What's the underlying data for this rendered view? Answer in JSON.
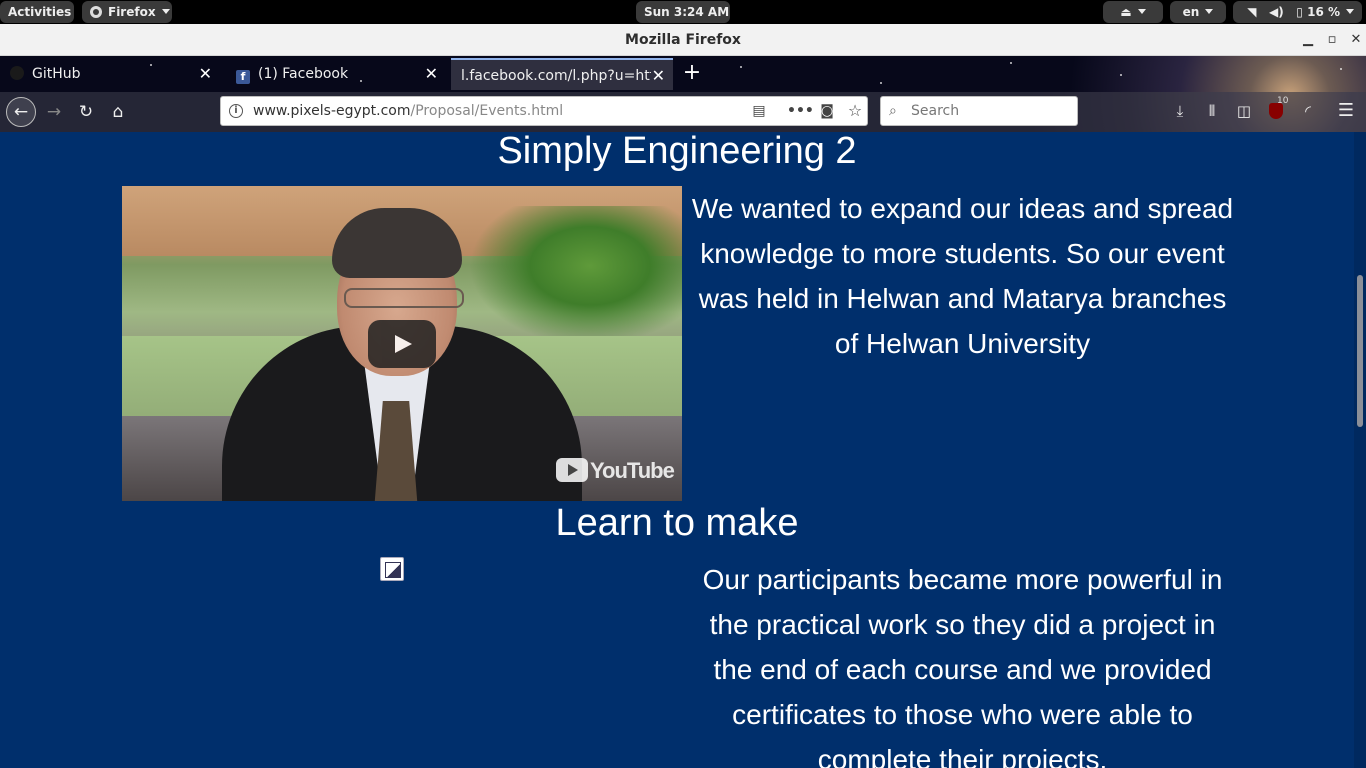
{
  "topbar": {
    "activities": "Activities",
    "app_menu": "Firefox",
    "clock": "Sun  3:24 AM",
    "language": "en",
    "battery": "16 %"
  },
  "window": {
    "title": "Mozilla Firefox"
  },
  "tabs": [
    {
      "title": "GitHub",
      "active": false
    },
    {
      "title": "(1) Facebook",
      "active": false
    },
    {
      "title": "l.facebook.com/l.php?u=http",
      "active": true
    }
  ],
  "navbar": {
    "url_host": "www.pixels-egypt.com",
    "url_path": "/Proposal/Events.html",
    "search_placeholder": "Search",
    "ublock_count": "10"
  },
  "page": {
    "section1": {
      "title": "Simply Engineering 2",
      "text": "We wanted to expand our ideas and spread knowledge to more students. So our event was held in Helwan and Matarya branches of Helwan University",
      "video_logo": "YouTube"
    },
    "section2": {
      "title": "Learn to make",
      "text": "Our participants became more powerful in the practical work so they did a project in the end of each course and we provided certificates to those who were able to complete their projects."
    }
  },
  "colors": {
    "page_background": "#002f6c",
    "text": "#ffffff"
  }
}
